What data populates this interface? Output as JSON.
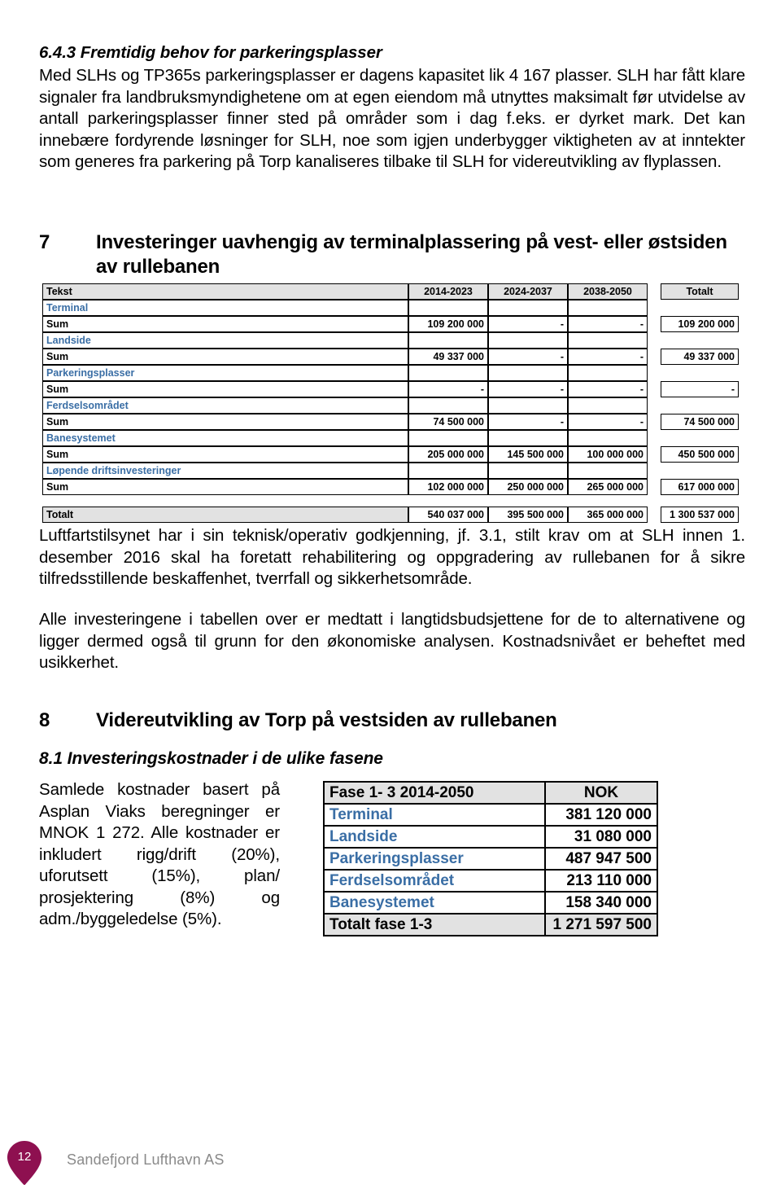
{
  "document": {
    "section_643": {
      "heading": "6.4.3 Fremtidig behov for parkeringsplasser",
      "body": "Med SLHs og TP365s parkeringsplasser er dagens kapasitet lik 4 167 plasser. SLH har fått klare signaler fra landbruksmyndighetene om at egen eiendom må utnyttes maksimalt før utvidelse av antall parkeringsplasser finner sted på områder som i dag f.eks. er dyrket mark. Det kan innebære fordyrende løsninger for SLH, noe som igjen underbygger viktigheten av at inntekter som generes fra parkering på Torp kanaliseres tilbake til SLH for videreutvikling av flyplassen."
    },
    "section_7": {
      "number": "7",
      "title": "Investeringer uavhengig av terminalplassering på vest- eller østsiden av rullebanen",
      "paragraph_1": "Luftfartstilsynet har i sin teknisk/operativ godkjenning, jf. 3.1, stilt krav om at SLH innen 1. desember 2016 skal ha foretatt rehabilitering og oppgradering av rullebanen for å sikre tilfredsstillende beskaffenhet, tverrfall og sikkerhetsområde.",
      "paragraph_2": "Alle investeringene i tabellen over er medtatt i langtidsbudsjettene for de to alternativene og ligger dermed også til grunn for den økonomiske analysen. Kostnadsnivået er beheftet med usikkerhet."
    },
    "section_8": {
      "number": "8",
      "title": "Videreutvikling av Torp på vestsiden av rullebanen",
      "sub_heading": "8.1 Investeringskostnader i de ulike fasene",
      "body": "Samlede kostnader basert på Asplan Viaks beregninger er MNOK 1 272. Alle kostnader er inkludert rigg/drift (20%), uforutsett (15%), plan/ prosjektering (8%) og adm./byggeledelse (5%)."
    },
    "table_investments": {
      "columns": [
        "Tekst",
        "2014-2023",
        "2024-2037",
        "2038-2050",
        "Totalt"
      ],
      "sum_label": "Sum",
      "groups": [
        {
          "category": "Terminal",
          "values": [
            "109 200 000",
            "-",
            "-",
            "109 200 000"
          ]
        },
        {
          "category": "Landside",
          "values": [
            "49 337 000",
            "-",
            "-",
            "49 337 000"
          ]
        },
        {
          "category": "Parkeringsplasser",
          "values": [
            "-",
            "-",
            "-",
            "-"
          ]
        },
        {
          "category": "Ferdselsområdet",
          "values": [
            "74 500 000",
            "-",
            "-",
            "74 500 000"
          ]
        },
        {
          "category": "Banesystemet",
          "values": [
            "205 000 000",
            "145 500 000",
            "100 000 000",
            "450 500 000"
          ]
        },
        {
          "category": "Løpende driftsinvesteringer",
          "values": [
            "102 000 000",
            "250 000 000",
            "265 000 000",
            "617 000 000"
          ]
        }
      ],
      "total_row": {
        "label": "Totalt",
        "values": [
          "540 037 000",
          "395 500 000",
          "365 000 000",
          "1 300 537 000"
        ]
      }
    },
    "table_phases": {
      "header": {
        "label": "Fase 1- 3  2014-2050",
        "unit": "NOK"
      },
      "rows": [
        {
          "label": "Terminal",
          "value": "381 120 000"
        },
        {
          "label": "Landside",
          "value": "31 080 000"
        },
        {
          "label": "Parkeringsplasser",
          "value": "487 947 500"
        },
        {
          "label": "Ferdselsområdet",
          "value": "213 110 000"
        },
        {
          "label": "Banesystemet",
          "value": "158 340 000"
        }
      ],
      "total": {
        "label": "Totalt fase 1-3",
        "value": "1 271 597 500"
      }
    },
    "footer": {
      "page_number": "12",
      "organisation": "Sandefjord Lufthavn AS"
    },
    "colors": {
      "category_text": "#3a6ea5",
      "header_fill": "#e2e2e2",
      "pin_fill": "#8e1050",
      "footer_text": "#8a8a8a"
    }
  }
}
